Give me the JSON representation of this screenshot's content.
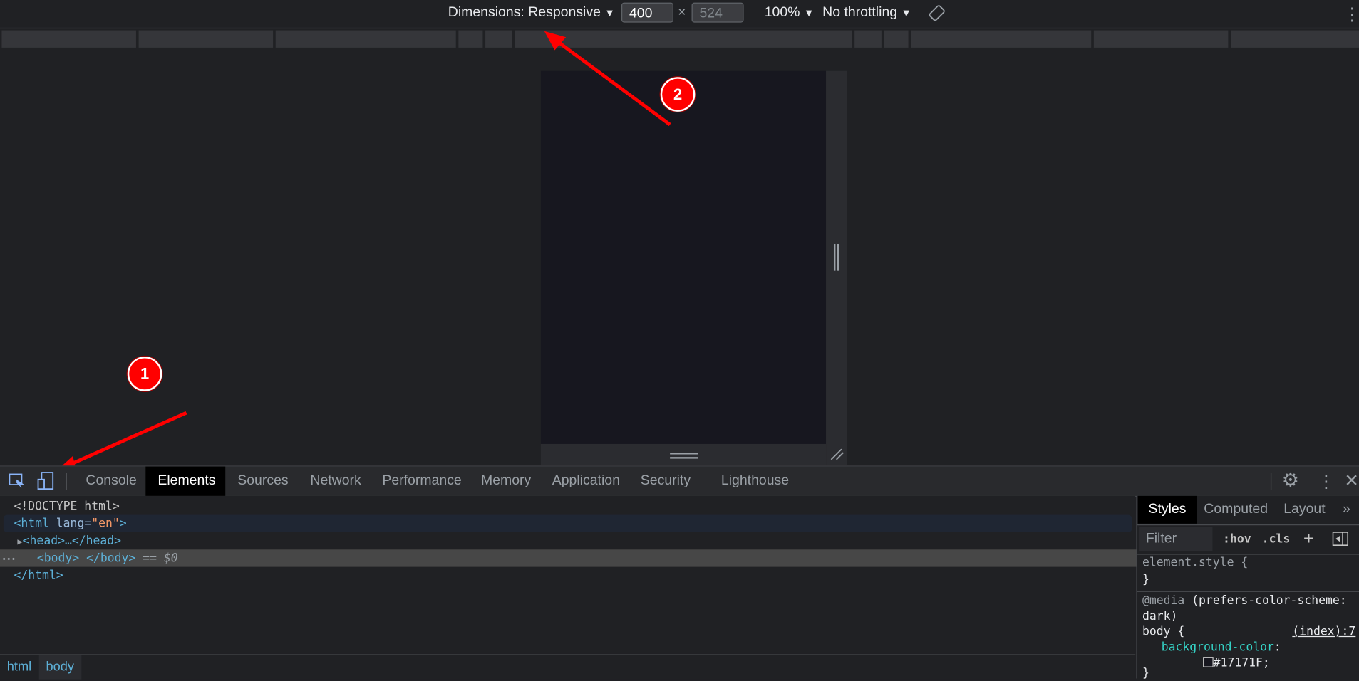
{
  "toolbar": {
    "dimensions_label": "Dimensions: Responsive",
    "width_value": "400",
    "times": "×",
    "height_value": "524",
    "zoom_label": "100%",
    "throttling_label": "No throttling",
    "caret": "▼",
    "more": "⋮",
    "rotate_icon": "rotate-icon"
  },
  "device": {
    "background_color": "#17171F"
  },
  "annotations": [
    {
      "number": "1",
      "color": "#FF0000"
    },
    {
      "number": "2",
      "color": "#FF0000"
    }
  ],
  "devtools_tabs": [
    {
      "label": "Console"
    },
    {
      "label": "Elements",
      "active": true
    },
    {
      "label": "Sources"
    },
    {
      "label": "Network"
    },
    {
      "label": "Performance"
    },
    {
      "label": "Memory"
    },
    {
      "label": "Application"
    },
    {
      "label": "Security"
    },
    {
      "label": "Lighthouse"
    }
  ],
  "dom_tree": {
    "doctype": "<!DOCTYPE html>",
    "html_open": "<html",
    "lang_attr": "lang",
    "lang_val": "\"en\"",
    "gt": ">",
    "head": "<head>…</head>",
    "body": "<body> </body>",
    "body_sel": "== $0",
    "html_close": "</html>",
    "dots": "•••"
  },
  "breadcrumbs": [
    "html",
    "body"
  ],
  "styles_pane": {
    "tabs": [
      "Styles",
      "Computed",
      "Layout"
    ],
    "more": "»",
    "filter_placeholder": "Filter",
    "hov": ":hov",
    "cls": ".cls",
    "plus": "+",
    "element_style": "element.style {",
    "close_brace": "}",
    "media_at": "@media",
    "media_query": " (prefers-color-scheme:",
    "media_query2": "dark)",
    "selector": "body {",
    "source": "(index):7",
    "prop": "background-color",
    "colon": ":",
    "value": "#17171F;"
  }
}
